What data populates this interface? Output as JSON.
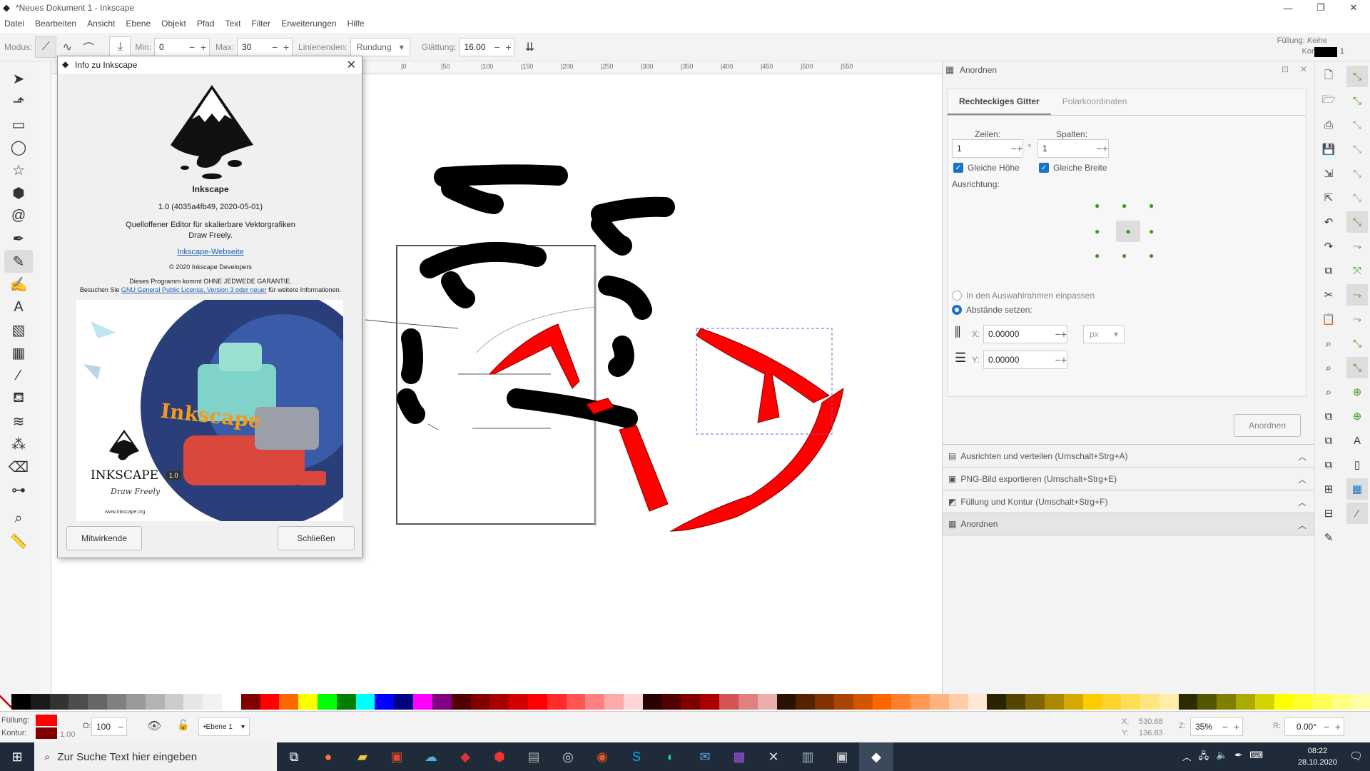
{
  "app": {
    "title": "*Neues Dokument 1 - Inkscape"
  },
  "menu": [
    "Datei",
    "Bearbeiten",
    "Ansicht",
    "Ebene",
    "Objekt",
    "Pfad",
    "Text",
    "Filter",
    "Erweiterungen",
    "Hilfe"
  ],
  "toolctrl": {
    "modus_label": "Modus:",
    "min_label": "Min:",
    "min_value": "0",
    "max_label": "Max:",
    "max_value": "30",
    "linienenden_label": "Linienenden:",
    "linienenden_value": "Rundung",
    "glaettung_label": "Glättung:",
    "glaettung_value": "16.00",
    "fuellung_label": "Füllung:",
    "fuellung_value": "Keine",
    "kontur_label": "Kontur:",
    "kontur_value": "1"
  },
  "ruler": {
    "ticks": [
      "|0",
      "|50",
      "|100",
      "|150",
      "|200",
      "|250",
      "|300",
      "|350",
      "|400",
      "|450",
      "|500",
      "|550"
    ]
  },
  "about": {
    "title": "Info zu Inkscape",
    "app_name": "Inkscape",
    "version": "1.0 (4035a4fb49, 2020-05-01)",
    "tagline1": "Quelloffener Editor für skalierbare Vektorgrafiken",
    "tagline2": "Draw Freely.",
    "website_link": "Inkscape-Webseite",
    "copyright": "© 2020 Inkscape Developers",
    "warranty": "Dieses Programm kommt OHNE JEDWEDE GARANTIE.",
    "license_prefix": "Besuchen Sie",
    "license_link": "GNU General Public License, Version 3 oder neuer",
    "license_suffix": "für weitere Informationen.",
    "splash_brand": "INKSCAPE",
    "splash_version": "1.0",
    "splash_slogan": "Draw Freely",
    "splash_url": "www.inkscape.org",
    "splash_word": "Inkscape",
    "contributors_button": "Mitwirkende",
    "close_button": "Schließen"
  },
  "panel": {
    "header": "Anordnen",
    "tabs": [
      "Rechteckiges Gitter",
      "Polarkoordinaten"
    ],
    "zeilen_label": "Zeilen:",
    "zeilen_value": "1",
    "spalten_label": "Spalten:",
    "spalten_value": "1",
    "gleiche_hoehe": "Gleiche Höhe",
    "gleiche_breite": "Gleiche Breite",
    "ausrichtung": "Ausrichtung:",
    "radio_fit": "In den Auswahlrahmen einpassen",
    "radio_spacing": "Abstände setzen:",
    "x_label": "X:",
    "x_value": "0.00000",
    "y_label": "Y:",
    "y_value": "0.00000",
    "unit": "px",
    "apply_button": "Anordnen",
    "docks": [
      "Ausrichten und verteilen (Umschalt+Strg+A)",
      "PNG-Bild exportieren (Umschalt+Strg+E)",
      "Füllung und Kontur (Umschalt+Strg+F)",
      "Anordnen"
    ]
  },
  "status": {
    "fuellung_label": "Füllung:",
    "kontur_label": "Kontur:",
    "kontur_width": "1.00",
    "opacity_label": "O:",
    "opacity_value": "100",
    "layer": "•Ebene 1",
    "x_label": "X:",
    "x_value": "530.68",
    "y_label": "Y:",
    "y_value": "136.83",
    "zoom_label": "Z:",
    "zoom_value": "35%",
    "rot_label": "R:",
    "rot_value": "0.00°"
  },
  "taskbar": {
    "search_placeholder": "Zur Suche Text hier eingeben",
    "time": "08:22",
    "date": "28.10.2020"
  },
  "colors": {
    "fill": "#ff0000",
    "stroke": "#800000",
    "accent_green": "#3f9a1f"
  },
  "palette": [
    "#000000",
    "#1a1a1a",
    "#333333",
    "#4d4d4d",
    "#666666",
    "#808080",
    "#999999",
    "#b3b3b3",
    "#cccccc",
    "#e6e6e6",
    "#f2f2f2",
    "#ffffff",
    "#800000",
    "#ff0000",
    "#ff6600",
    "#ffff00",
    "#00ff00",
    "#008000",
    "#00ffff",
    "#0000ff",
    "#000080",
    "#ff00ff",
    "#800080",
    "#550000",
    "#800000",
    "#aa0000",
    "#d40000",
    "#ff0000",
    "#ff2a2a",
    "#ff5555",
    "#ff8080",
    "#ffaaaa",
    "#ffd5d5",
    "#2b0000",
    "#550000",
    "#800000",
    "#aa0000",
    "#d45555",
    "#e08080",
    "#e9afaf",
    "#2b1100",
    "#552200",
    "#803300",
    "#aa4400",
    "#d45500",
    "#ff6600",
    "#ff7f2a",
    "#ff9955",
    "#ffb380",
    "#ffccaa",
    "#ffe6d5",
    "#2b2200",
    "#554400",
    "#806600",
    "#aa8800",
    "#d4aa00",
    "#ffcc00",
    "#ffd42a",
    "#ffdd55",
    "#ffe680",
    "#ffeeaa",
    "#2b2b00",
    "#555500",
    "#808000",
    "#aaaa00",
    "#d4d400",
    "#ffff00",
    "#ffff2a",
    "#ffff55",
    "#ffff80",
    "#ffffaa"
  ]
}
